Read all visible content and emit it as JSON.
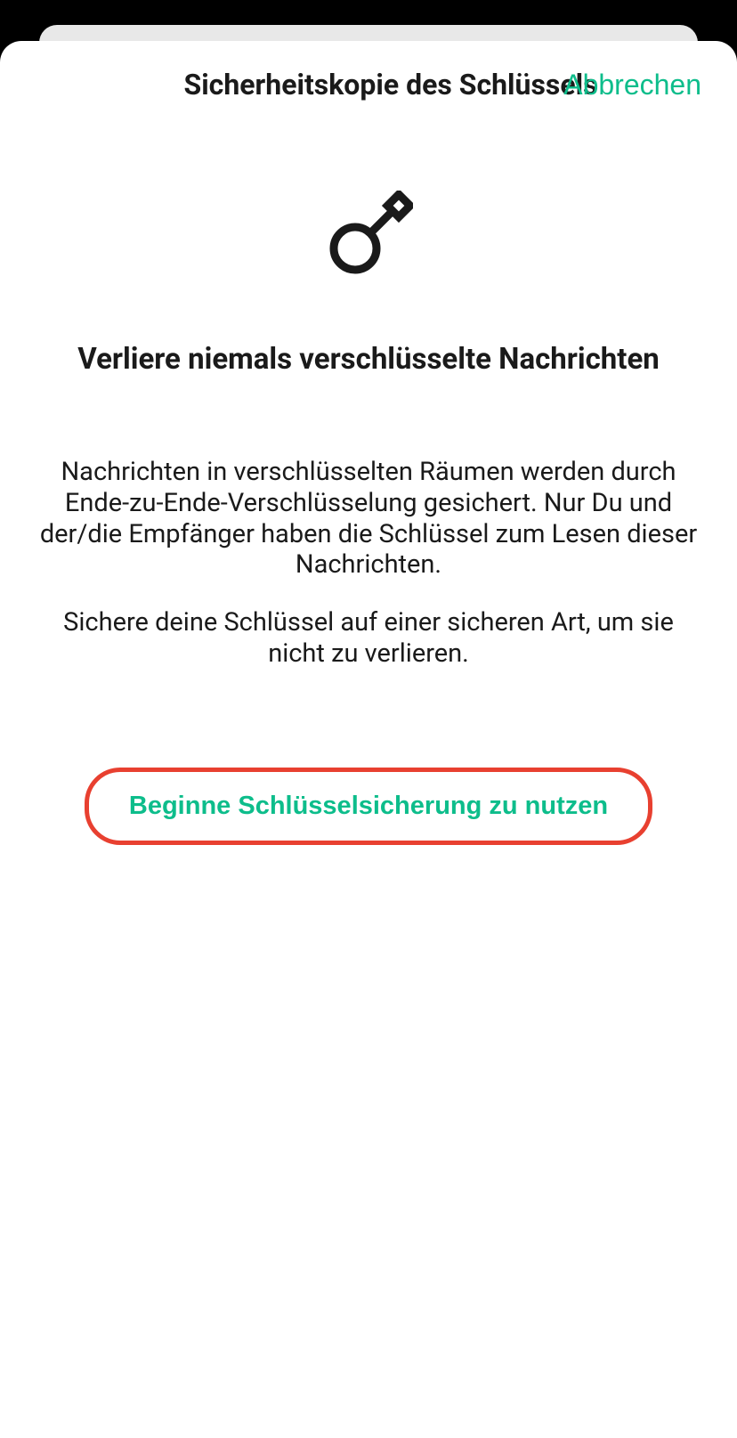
{
  "header": {
    "title": "Sicherheitskopie des Schlüssels",
    "cancel_label": "Abbrechen"
  },
  "content": {
    "heading": "Verliere niemals verschlüsselte Nachrichten",
    "description1": "Nachrichten in verschlüsselten Räumen werden durch Ende-zu-Ende-Verschlüsselung gesichert. Nur Du und der/die Empfänger haben die Schlüssel zum Lesen dieser Nachrichten.",
    "description2": "Sichere deine Schlüssel auf einer sicheren Art, um sie nicht zu verlieren.",
    "primary_button_label": "Beginne Schlüsselsicherung zu nutzen"
  },
  "colors": {
    "accent": "#0dbd8b",
    "highlight_border": "#e84030"
  }
}
